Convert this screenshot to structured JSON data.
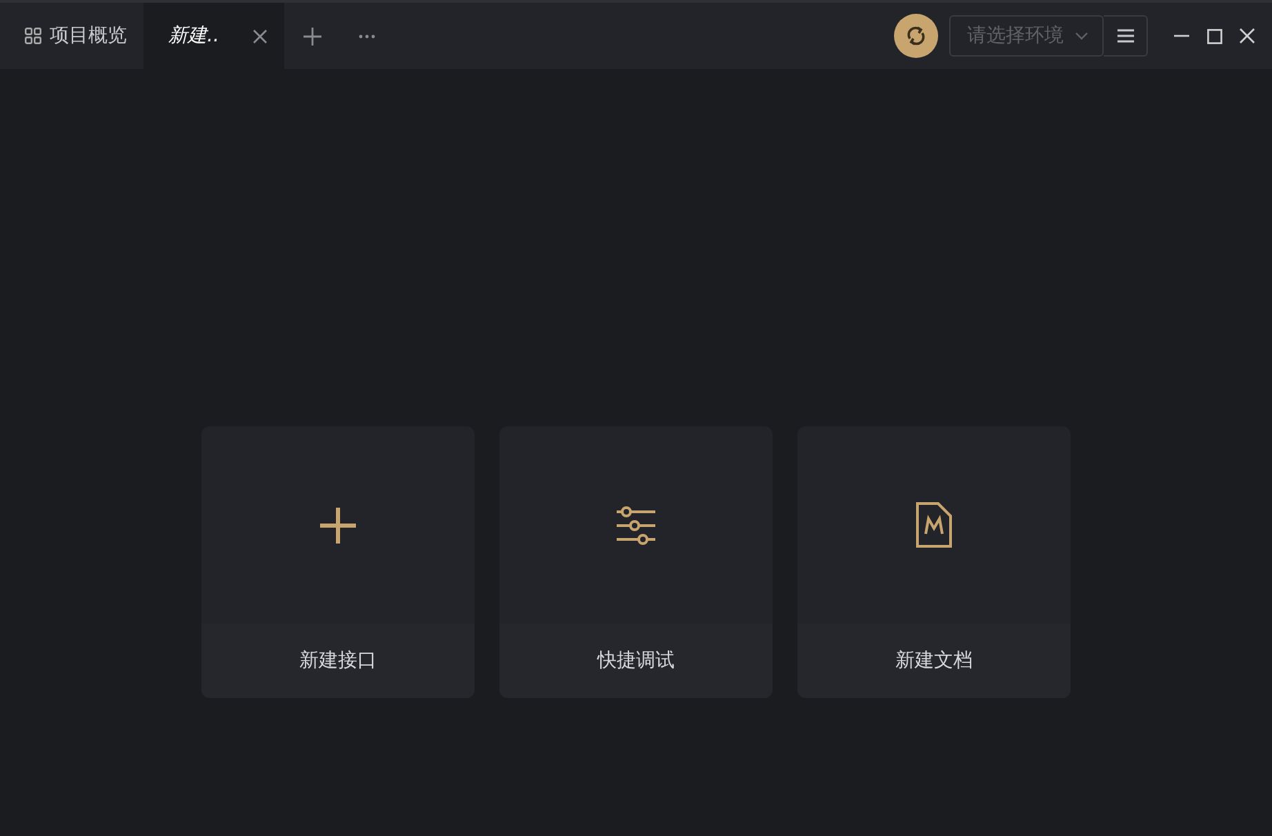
{
  "tabs": [
    {
      "label": "项目概览",
      "selected": false,
      "kind": "overview"
    },
    {
      "label": "新建..",
      "selected": true,
      "kind": "draft"
    }
  ],
  "environment": {
    "placeholder": "请选择环境"
  },
  "cards": [
    {
      "kind": "plus",
      "label": "新建接口"
    },
    {
      "kind": "sliders",
      "label": "快捷调试"
    },
    {
      "kind": "doc",
      "label": "新建文档"
    }
  ]
}
